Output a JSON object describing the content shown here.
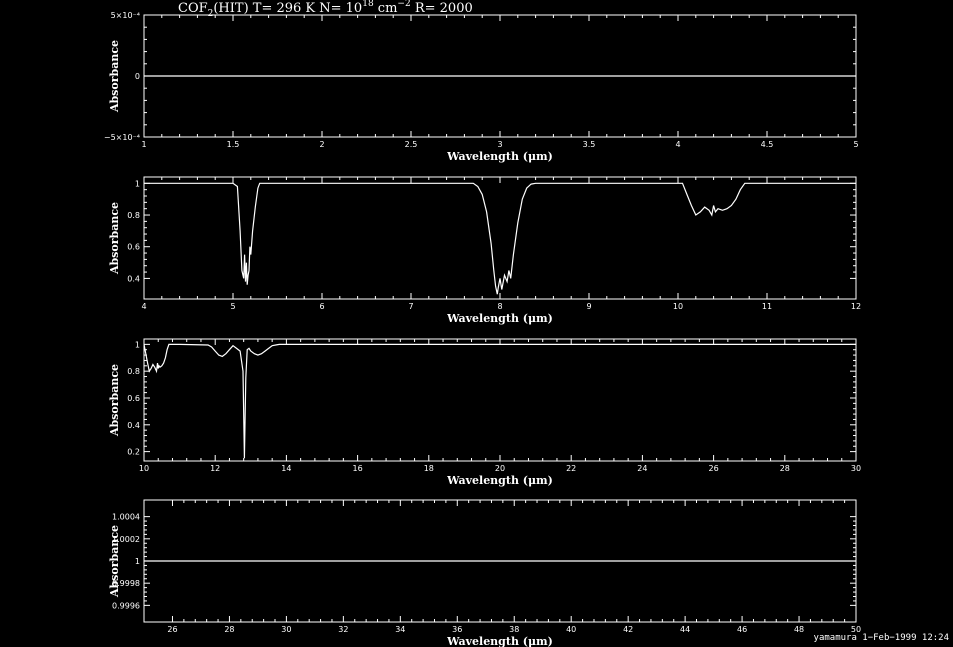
{
  "header": {
    "title_main": "COF",
    "title_sub": "2",
    "title_mid": "(HIT) T= 296 K N= 10",
    "title_sup": "18",
    "title_unit": " cm",
    "title_sup2": "−2",
    "title_end": " R= 2000"
  },
  "footer": {
    "stamp": "yamamura  1−Feb−1999 12:24"
  },
  "colors": {
    "background": "#000000",
    "foreground": "#ffffff"
  },
  "chart_data": [
    {
      "type": "line",
      "xlabel": "Wavelength (μm)",
      "ylabel": "Absorbance",
      "xlim": [
        1,
        5
      ],
      "ylim": [
        -0.0005,
        0.0005
      ],
      "xticks": [
        1,
        1.5,
        2,
        2.5,
        3,
        3.5,
        4,
        4.5,
        5
      ],
      "xtick_labels": [
        "1",
        "1.5",
        "2",
        "2.5",
        "3",
        "3.5",
        "4",
        "4.5",
        "5"
      ],
      "yticks": [
        -0.0005,
        0,
        0.0005
      ],
      "ytick_labels": [
        "−5×10⁻⁴",
        "0",
        "5×10⁻⁴"
      ],
      "series": [
        {
          "x": [
            1,
            5
          ],
          "y": [
            0,
            0
          ]
        }
      ]
    },
    {
      "type": "line",
      "xlabel": "Wavelength (μm)",
      "ylabel": "Absorbance",
      "xlim": [
        4,
        12
      ],
      "ylim": [
        0.27,
        1.04
      ],
      "xticks": [
        4,
        5,
        6,
        7,
        8,
        9,
        10,
        11,
        12
      ],
      "xtick_labels": [
        "4",
        "5",
        "6",
        "7",
        "8",
        "9",
        "10",
        "11",
        "12"
      ],
      "yticks": [
        0.4,
        0.6,
        0.8,
        1
      ],
      "ytick_labels": [
        "0.4",
        "0.6",
        "0.8",
        "1"
      ],
      "series": [
        {
          "x": [
            4,
            5.0,
            5.05,
            5.08,
            5.1,
            5.12,
            5.13,
            5.14,
            5.15,
            5.16,
            5.17,
            5.18,
            5.19,
            5.2,
            5.22,
            5.25,
            5.28,
            5.3,
            5.4,
            7.7,
            7.75,
            7.8,
            7.85,
            7.9,
            7.93,
            7.95,
            7.97,
            7.98,
            8.0,
            8.02,
            8.05,
            8.08,
            8.1,
            8.12,
            8.15,
            8.2,
            8.25,
            8.3,
            8.35,
            8.4,
            8.5,
            10.05,
            10.1,
            10.15,
            10.2,
            10.25,
            10.3,
            10.35,
            10.38,
            10.4,
            10.42,
            10.45,
            10.5,
            10.55,
            10.6,
            10.65,
            10.7,
            10.75,
            12
          ],
          "y": [
            1,
            1,
            0.98,
            0.7,
            0.45,
            0.4,
            0.55,
            0.38,
            0.5,
            0.36,
            0.42,
            0.45,
            0.6,
            0.55,
            0.7,
            0.85,
            0.97,
            1,
            1,
            1,
            0.98,
            0.93,
            0.82,
            0.62,
            0.45,
            0.35,
            0.3,
            0.34,
            0.4,
            0.33,
            0.42,
            0.38,
            0.45,
            0.4,
            0.55,
            0.75,
            0.9,
            0.97,
            0.995,
            1,
            1,
            1,
            0.93,
            0.86,
            0.8,
            0.82,
            0.85,
            0.83,
            0.8,
            0.86,
            0.82,
            0.84,
            0.83,
            0.84,
            0.86,
            0.9,
            0.96,
            1,
            1
          ]
        }
      ]
    },
    {
      "type": "line",
      "xlabel": "Wavelength (μm)",
      "ylabel": "Absorbance",
      "xlim": [
        10,
        30
      ],
      "ylim": [
        0.13,
        1.04
      ],
      "xticks": [
        10,
        12,
        14,
        16,
        18,
        20,
        22,
        24,
        26,
        28,
        30
      ],
      "xtick_labels": [
        "10",
        "12",
        "14",
        "16",
        "18",
        "20",
        "22",
        "24",
        "26",
        "28",
        "30"
      ],
      "yticks": [
        0.2,
        0.4,
        0.6,
        0.8,
        1
      ],
      "ytick_labels": [
        "0.2",
        "0.4",
        "0.6",
        "0.8",
        "1"
      ],
      "series": [
        {
          "x": [
            10,
            10.05,
            10.1,
            10.15,
            10.2,
            10.25,
            10.3,
            10.35,
            10.38,
            10.4,
            10.42,
            10.45,
            10.5,
            10.55,
            10.6,
            10.65,
            10.7,
            10.75,
            11,
            11.8,
            11.9,
            12.0,
            12.1,
            12.2,
            12.3,
            12.4,
            12.5,
            12.6,
            12.7,
            12.78,
            12.82,
            12.86,
            12.9,
            12.95,
            13.0,
            13.1,
            13.2,
            13.3,
            13.4,
            13.5,
            13.6,
            13.7,
            13.8,
            14.0,
            30
          ],
          "y": [
            1,
            0.93,
            0.86,
            0.8,
            0.82,
            0.85,
            0.83,
            0.8,
            0.86,
            0.82,
            0.84,
            0.83,
            0.84,
            0.86,
            0.9,
            0.96,
            1,
            1,
            1,
            0.995,
            0.98,
            0.95,
            0.92,
            0.91,
            0.93,
            0.96,
            0.99,
            0.97,
            0.95,
            0.8,
            0.15,
            0.75,
            0.96,
            0.97,
            0.95,
            0.93,
            0.92,
            0.93,
            0.95,
            0.97,
            0.99,
            0.995,
            1,
            1,
            1
          ]
        }
      ]
    },
    {
      "type": "line",
      "xlabel": "Wavelength (μm)",
      "ylabel": "Absorbance",
      "xlim": [
        25,
        50
      ],
      "ylim": [
        0.99945,
        1.00055
      ],
      "xticks": [
        26,
        28,
        30,
        32,
        34,
        36,
        38,
        40,
        42,
        44,
        46,
        48,
        50
      ],
      "xtick_labels": [
        "26",
        "28",
        "30",
        "32",
        "34",
        "36",
        "38",
        "40",
        "42",
        "44",
        "46",
        "48",
        "50"
      ],
      "yticks": [
        0.9996,
        0.9998,
        1,
        1.0002,
        1.0004
      ],
      "ytick_labels": [
        "0.9996",
        "0.9998",
        "1",
        "1.0002",
        "1.0004"
      ],
      "series": [
        {
          "x": [
            25,
            50
          ],
          "y": [
            1,
            1
          ]
        }
      ]
    }
  ]
}
